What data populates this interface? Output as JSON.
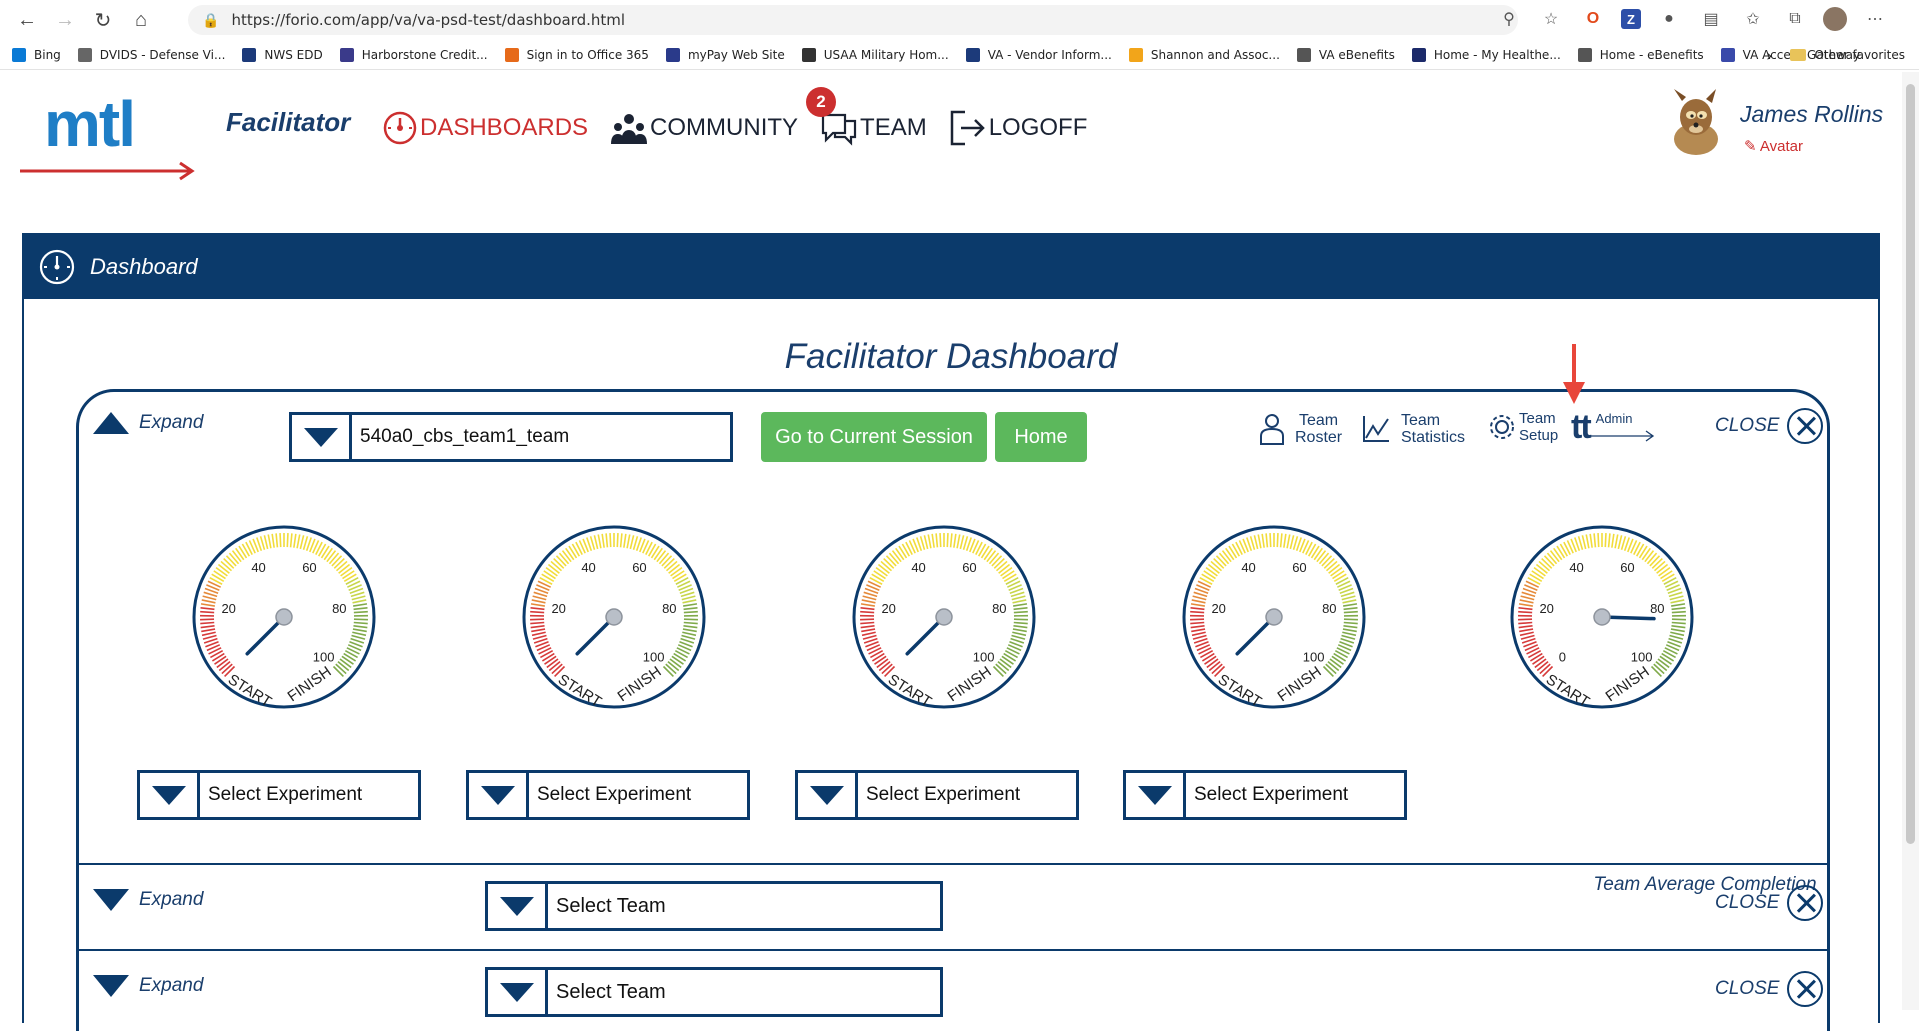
{
  "browser": {
    "url": "https://forio.com/app/va/va-psd-test/dashboard.html",
    "bookmarks": [
      {
        "label": "Bing",
        "color": "#0a7ad5"
      },
      {
        "label": "DVIDS - Defense Vi...",
        "color": "#666666"
      },
      {
        "label": "NWS EDD",
        "color": "#1c3a7a"
      },
      {
        "label": "Harborstone Credit...",
        "color": "#3a3a8a"
      },
      {
        "label": "Sign in to Office 365",
        "color": "#e66a1a"
      },
      {
        "label": "myPay Web Site",
        "color": "#2a3a8a"
      },
      {
        "label": "USAA Military Hom...",
        "color": "#333333"
      },
      {
        "label": "VA - Vendor Inform...",
        "color": "#1c3a7a"
      },
      {
        "label": "Shannon and Assoc...",
        "color": "#f2a51a"
      },
      {
        "label": "VA eBenefits",
        "color": "#555555"
      },
      {
        "label": "Home - My Healthe...",
        "color": "#1c2a6a"
      },
      {
        "label": "Home - eBenefits",
        "color": "#555555"
      },
      {
        "label": "VA Access Gateway",
        "color": "#3a4aaa"
      }
    ],
    "other_favorites": "Other favorites"
  },
  "header": {
    "logo_text": "mtl",
    "role": "Facilitator",
    "nav": [
      {
        "label": "DASHBOARDS",
        "icon": "dashboard-gauge-icon",
        "active": true
      },
      {
        "label": "COMMUNITY",
        "icon": "community-people-icon",
        "active": false
      },
      {
        "label": "TEAM",
        "icon": "team-chat-icon",
        "active": false
      },
      {
        "label": "LOGOFF",
        "icon": "logoff-icon",
        "active": false
      }
    ],
    "team_badge": "2",
    "user_name": "James Rollins",
    "avatar_link": "Avatar"
  },
  "panel": {
    "title": "Dashboard",
    "page_title": "Facilitator Dashboard"
  },
  "team_section": {
    "expand_label": "Expand",
    "team_select": "540a0_cbs_team1_team",
    "go_button": "Go to Current Session",
    "home_button": "Home",
    "tools": {
      "roster": [
        "Team",
        "Roster"
      ],
      "statistics": [
        "Team",
        "Statistics"
      ],
      "setup": [
        "Team",
        "Setup"
      ],
      "admin_abbr": "tt",
      "admin": "Admin"
    },
    "close_label": "CLOSE",
    "gauges": [
      {
        "value": 0
      },
      {
        "value": 0
      },
      {
        "value": 0
      },
      {
        "value": 0
      },
      {
        "value": 84
      }
    ],
    "gauge_labels": {
      "t20": "20",
      "t40": "40",
      "t60": "60",
      "t80": "80",
      "t100": "100",
      "t0": "0",
      "start": "START",
      "finish": "FINISH"
    },
    "average_caption": "Team Average Completion",
    "experiment_placeholder": "Select Experiment"
  },
  "rows": [
    {
      "expand_label": "Expand",
      "team_select": "Select Team",
      "close_label": "CLOSE"
    },
    {
      "expand_label": "Expand",
      "team_select": "Select Team",
      "close_label": "CLOSE"
    }
  ],
  "colors": {
    "navy": "#0b3a6b",
    "brand_blue": "#1f7ec6",
    "red": "#cc2f2f",
    "green_button": "#5cb85c",
    "annotation_arrow": "#e8463a"
  }
}
